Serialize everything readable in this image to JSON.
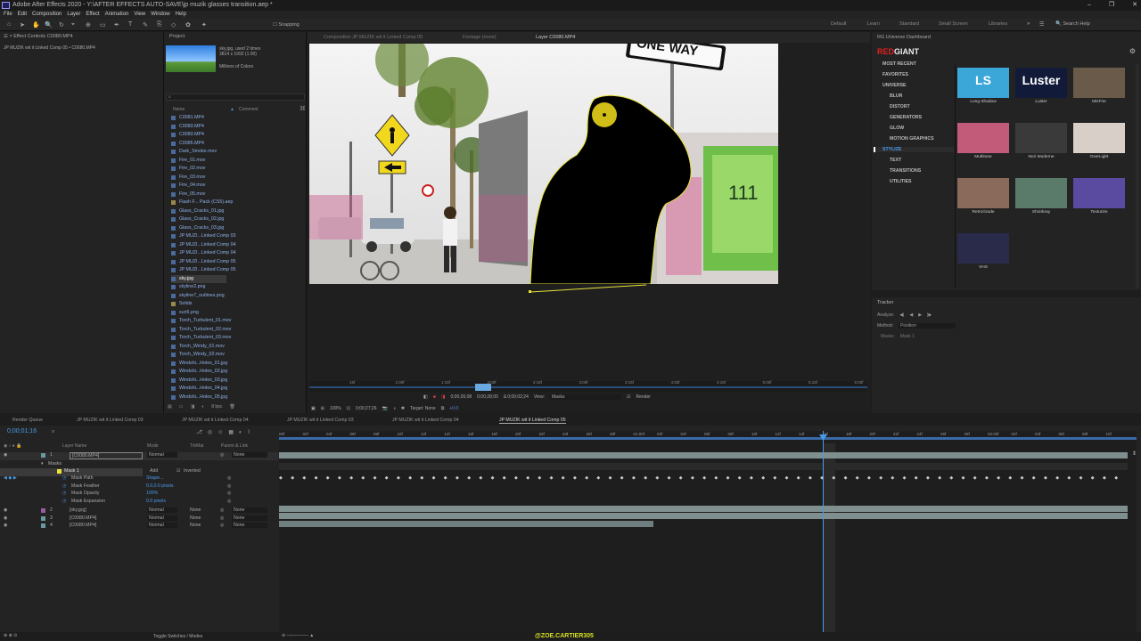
{
  "app": {
    "title": "Adobe After Effects 2020 - Y:\\AFTER EFFECTS AUTO-SAVE\\jp muzik glasses transition.aep *"
  },
  "window_controls": [
    "–",
    "❐",
    "✕"
  ],
  "menu": [
    "File",
    "Edit",
    "Composition",
    "Layer",
    "Effect",
    "Animation",
    "View",
    "Window",
    "Help"
  ],
  "toolbar": {
    "snapping_label": "Snapping",
    "workspaces": [
      "Default",
      "Learn",
      "Standard",
      "Small Screen",
      "Libraries"
    ],
    "search_help": "Search Help"
  },
  "effect_controls": {
    "tab": "Effect Controls C0080.MP4",
    "subtitle": "JP MUZIK wit it Linked Comp 05 • C0080.MP4"
  },
  "project": {
    "tab": "Project",
    "thumb_name": "sky.jpg",
    "thumb_used": ", used 2 times",
    "thumb_dims": "3814 x 1992 (1.00)",
    "thumb_colors": "Millions of Colors",
    "col_name": "Name",
    "col_comment": "Comment",
    "files": [
      {
        "name": "C0081.MP4",
        "type": "file"
      },
      {
        "name": "C0083.MP4",
        "type": "file"
      },
      {
        "name": "C0083.MP4",
        "type": "file"
      },
      {
        "name": "C0085.MP4",
        "type": "file"
      },
      {
        "name": "Dark_Smoke.mov",
        "type": "file"
      },
      {
        "name": "Fire_01.mov",
        "type": "file"
      },
      {
        "name": "Fire_02.mov",
        "type": "file"
      },
      {
        "name": "Fire_03.mov",
        "type": "file"
      },
      {
        "name": "Fire_04.mov",
        "type": "file"
      },
      {
        "name": "Fire_05.mov",
        "type": "file"
      },
      {
        "name": "Flash F... Pack (CS5).aep",
        "type": "folder"
      },
      {
        "name": "Glass_Cracks_01.jpg",
        "type": "file"
      },
      {
        "name": "Glass_Cracks_02.jpg",
        "type": "file"
      },
      {
        "name": "Glass_Cracks_03.jpg",
        "type": "file"
      },
      {
        "name": "JP MUZI...Linked Comp 03",
        "type": "file"
      },
      {
        "name": "JP MUZI...Linked Comp 04",
        "type": "file"
      },
      {
        "name": "JP MUZI...Linked Comp 04",
        "type": "file"
      },
      {
        "name": "JP MUZI...Linked Comp 05",
        "type": "file"
      },
      {
        "name": "JP MUZI...Linked Comp 05",
        "type": "file"
      },
      {
        "name": "sky.jpg",
        "type": "selected"
      },
      {
        "name": "skyline2.png",
        "type": "file"
      },
      {
        "name": "skyline7_outlines.png",
        "type": "file"
      },
      {
        "name": "Solids",
        "type": "folder"
      },
      {
        "name": "sun5.png",
        "type": "file"
      },
      {
        "name": "Torch_Turbulent_01.mov",
        "type": "file"
      },
      {
        "name": "Torch_Turbulent_02.mov",
        "type": "file"
      },
      {
        "name": "Torch_Turbulent_03.mov",
        "type": "file"
      },
      {
        "name": "Torch_Windy_01.mov",
        "type": "file"
      },
      {
        "name": "Torch_Windy_02.mov",
        "type": "file"
      },
      {
        "name": "Windshi...Holes_01.jpg",
        "type": "file"
      },
      {
        "name": "Windshi...Holes_02.jpg",
        "type": "file"
      },
      {
        "name": "Windshi...Holes_03.jpg",
        "type": "file"
      },
      {
        "name": "Windshi...Holes_04.jpg",
        "type": "file"
      },
      {
        "name": "Windshi...Holes_05.jpg",
        "type": "file"
      }
    ],
    "bpc": "8 bpc"
  },
  "composition": {
    "tabs": [
      "Composition JP MUZIK wit it Linked Comp 05",
      "Footage (none)",
      "Layer C0080.MP4"
    ],
    "sign_text": "ONE WAY",
    "ruler_labels": [
      "15f",
      "1:00f",
      "1:15f",
      "2:00f",
      "2:15f",
      "3:00f",
      "3:15f",
      "4:00f",
      "4:15f",
      "5:00f",
      "5:15f",
      "6:00f"
    ],
    "start_time": "0;00;26;08",
    "end_time": "0;00;28;00",
    "duration": "Δ 0;00;02;24",
    "view_label": "View:",
    "view_value": "Masks",
    "render_label": "Render",
    "zoom": "100%",
    "current_time": "0;00;27;26",
    "target": "Target: None",
    "offset": "+0.0"
  },
  "red_giant": {
    "tab": "RG Universe Dashboard",
    "brand_red": "RED",
    "brand_white": "GIANT",
    "categories": [
      "MOST RECENT",
      "FAVORITES",
      "UNIVERSE",
      "BLUR",
      "DISTORT",
      "GENERATORS",
      "GLOW",
      "MOTION GRAPHICS",
      "STYLIZE",
      "TEXT",
      "TRANSITIONS",
      "UTILITIES"
    ],
    "active_category": "STYLIZE",
    "tiles": [
      {
        "label": "Long Shadow",
        "tile_text": "LS",
        "color": "#3aa7d8"
      },
      {
        "label": "Luster",
        "tile_text": "Luster",
        "color": "#121a3a"
      },
      {
        "label": "MisFire",
        "tile_text": "",
        "color": "#6a5a4a"
      },
      {
        "label": "Multitone",
        "tile_text": "",
        "color": "#c25a7a"
      },
      {
        "label": "Noir Moderne",
        "tile_text": "",
        "color": "#3a3a3a"
      },
      {
        "label": "OverLight",
        "tile_text": "",
        "color": "#d8cfc8"
      },
      {
        "label": "RetroGrade",
        "tile_text": "",
        "color": "#8a6a5a"
      },
      {
        "label": "Shrinkray",
        "tile_text": "",
        "color": "#5a7a6a"
      },
      {
        "label": "Texturize",
        "tile_text": "",
        "color": "#5a4aa0"
      },
      {
        "label": "VHS",
        "tile_text": "",
        "color": "#2a2a4a"
      }
    ]
  },
  "tracker": {
    "title": "Tracker",
    "analyze": "Analyze:",
    "method_label": "Method:",
    "method_value": "Position",
    "masks_label": "Masks:",
    "masks_value": "Mask 1"
  },
  "timeline": {
    "tabs": [
      "Render Queue",
      "JP MUZIK wit it Linked Comp 03",
      "JP MUZIK wit it Linked Comp 04",
      "JP MUZIK wit it Linked Comp 03",
      "JP MUZIK wit it Linked Comp 04",
      "JP MUZIK wit it Linked Comp 05"
    ],
    "timecode": "0;00;01;16",
    "col_layer_name": "Layer Name",
    "col_mode": "Mode",
    "col_trkmat": "TrkMat",
    "col_parent": "Parent & Link",
    "layers": [
      {
        "num": "1",
        "name": "[C0080.MP4]",
        "mode": "Normal",
        "trkmat": "",
        "parent": "None"
      },
      {
        "num": "2",
        "name": "[sky.jpg]",
        "mode": "Normal",
        "trkmat": "None",
        "parent": "None"
      },
      {
        "num": "3",
        "name": "[C0080.MP4]",
        "mode": "Normal",
        "trkmat": "None",
        "parent": "None"
      },
      {
        "num": "4",
        "name": "[C0080.MP4]",
        "mode": "Normal",
        "trkmat": "None",
        "parent": "None"
      }
    ],
    "masks_group": "Masks",
    "mask1": "Mask 1",
    "mask_add": "Add",
    "mask_inverted": "Inverted",
    "mask_props": [
      {
        "name": "Mask Path",
        "value": "Shape..."
      },
      {
        "name": "Mask Feather",
        "value": "0.0,0.0 pixels"
      },
      {
        "name": "Mask Opacity",
        "value": "100%"
      },
      {
        "name": "Mask Expansion",
        "value": "0.0 pixels"
      }
    ],
    "ruler": [
      "00f",
      "02f",
      "04f",
      "06f",
      "08f",
      "10f",
      "12f",
      "14f",
      "16f",
      "18f",
      "20f",
      "22f",
      "24f",
      "26f",
      "28f",
      "01:00f",
      "02f",
      "04f",
      "06f",
      "08f",
      "10f",
      "12f",
      "14f",
      "16f",
      "18f",
      "20f",
      "22f",
      "24f",
      "26f",
      "28f",
      "02:00f",
      "02f",
      "04f",
      "06f",
      "08f",
      "10f"
    ],
    "toggle_label": "Toggle Switches / Modes",
    "watermark": "@ZOE.CARTIER305"
  }
}
